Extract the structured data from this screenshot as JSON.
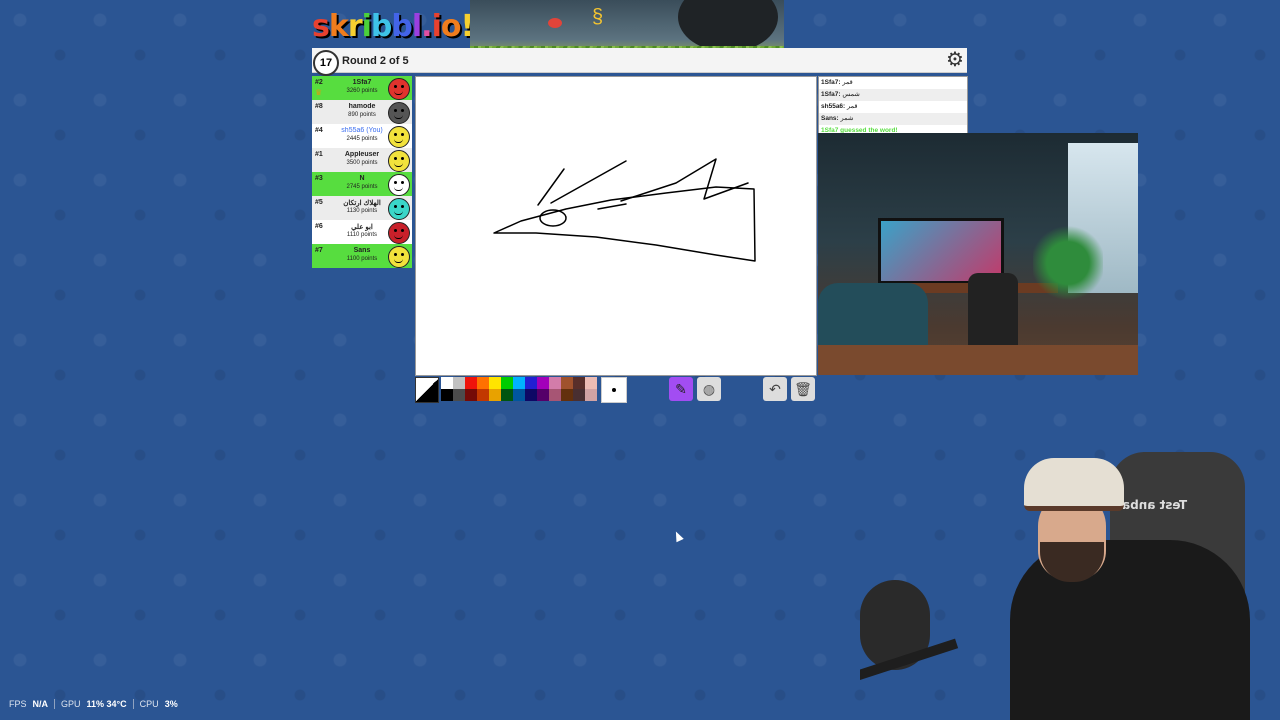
{
  "game": {
    "logo_text": "skribbl.io",
    "timer": "17",
    "round_label": "Round 2 of 5"
  },
  "players": [
    {
      "rank": "#2",
      "name": "1Sfa7",
      "points": "3260 points",
      "guessed": true,
      "crown": true,
      "avatar_color": "#e0332d"
    },
    {
      "rank": "#8",
      "name": "hamode",
      "points": "890 points",
      "guessed": false,
      "avatar_color": "#555555"
    },
    {
      "rank": "#4",
      "name": "sh55a6 (You)",
      "points": "2445 points",
      "guessed": false,
      "you": true,
      "avatar_color": "#f2e23c"
    },
    {
      "rank": "#1",
      "name": "Appleuser",
      "points": "3500 points",
      "guessed": false,
      "avatar_color": "#f2e23c"
    },
    {
      "rank": "#3",
      "name": "N",
      "points": "2745 points",
      "guessed": true,
      "avatar_color": "#ffffff"
    },
    {
      "rank": "#5",
      "name": "الهلاك ارتكان",
      "points": "1130 points",
      "guessed": false,
      "avatar_color": "#3ad6c8"
    },
    {
      "rank": "#6",
      "name": "ابو علي",
      "points": "1110 points",
      "guessed": false,
      "avatar_color": "#c8202a"
    },
    {
      "rank": "#7",
      "name": "Sans",
      "points": "1100 points",
      "guessed": true,
      "avatar_color": "#f2e23c"
    }
  ],
  "chat": [
    {
      "user": "1Sfa7:",
      "text": "قمر"
    },
    {
      "user": "1Sfa7:",
      "text": "شمس"
    },
    {
      "user": "sh55a6:",
      "text": "قمر"
    },
    {
      "user": "Sans:",
      "text": "شمر"
    },
    {
      "system": "1Sfa7 guessed the word!"
    }
  ],
  "palette": [
    "#ffffff",
    "#c1c1c1",
    "#ef130b",
    "#ff7100",
    "#ffe400",
    "#00cc00",
    "#00b2ff",
    "#231fd3",
    "#a300ba",
    "#d37caa",
    "#a0522d",
    "#592f2a",
    "#ecbcb4",
    "#000000",
    "#4c4c4c",
    "#740b07",
    "#c23800",
    "#e8a200",
    "#005510",
    "#00569e",
    "#0e0865",
    "#550069",
    "#a75574",
    "#63300d",
    "#492f31",
    "#d1a3a4"
  ],
  "tools": {
    "pen": "pencil-icon",
    "fill": "fill-bucket-icon",
    "undo": "undo-icon",
    "clear": "trash-icon"
  },
  "webcam": {
    "chair_text": "Test anba"
  },
  "stats": {
    "fps_label": "FPS",
    "fps_value": "N/A",
    "gpu_label": "GPU",
    "gpu_value": "11% 34°C",
    "cpu_label": "CPU",
    "cpu_value": "3%"
  }
}
